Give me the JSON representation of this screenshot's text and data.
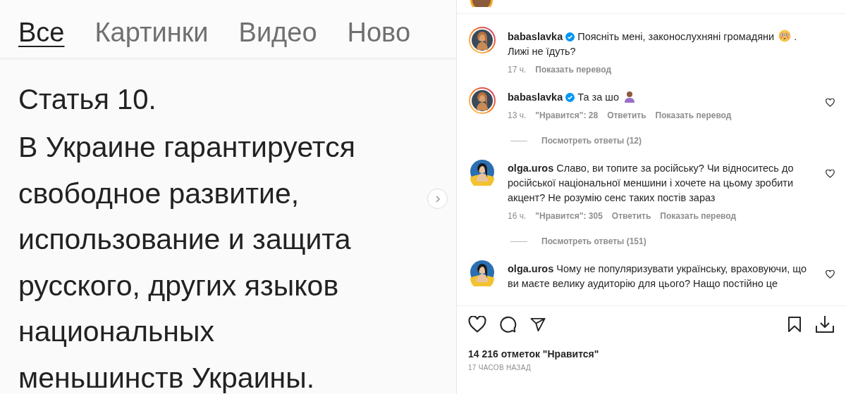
{
  "search_tabs": [
    {
      "label": "Все",
      "selected": true
    },
    {
      "label": "Картинки",
      "selected": false
    },
    {
      "label": "Видео",
      "selected": false
    },
    {
      "label": "Ново",
      "selected": false
    }
  ],
  "article": {
    "title": "Статья 10.",
    "text": "В Украине гарантируется\nсвободное развитие,\nиспользование и защита\nрусского, других языков\nнациональных\nменьшинств Украины."
  },
  "comments": [
    {
      "kind": "caption",
      "username": "babaslavka",
      "verified": true,
      "story_ring": true,
      "text": "Поясніть мені, законослухняні громадяни",
      "emoji": {
        "kind": "flushed"
      },
      "tail": " .\nЛижі не їдуть?",
      "time": "17 ч.",
      "translate": "Показать перевод"
    },
    {
      "kind": "comment",
      "username": "babaslavka",
      "verified": true,
      "story_ring": true,
      "text": "Та за шо",
      "emoji": {
        "kind": "shrug"
      },
      "time": "13 ч.",
      "likes": "\"Нравится\": 28",
      "reply": "Ответить",
      "translate": "Показать перевод",
      "replies": "Посмотреть ответы (12)"
    },
    {
      "kind": "comment",
      "username": "olga.uros",
      "verified": false,
      "story_ring": false,
      "text": "Славо, ви топите за російську? Чи відноситесь до російської національної меншини і хочете на цьому зробити акцент? Не розумію сенс таких постів зараз",
      "time": "16 ч.",
      "likes": "\"Нравится\": 305",
      "reply": "Ответить",
      "translate": "Показать перевод",
      "replies": "Посмотреть ответы (151)"
    },
    {
      "kind": "comment",
      "username": "olga.uros",
      "verified": false,
      "story_ring": false,
      "text": "Чому не популяризувати українську, враховуючи, що ви маєте велику аудиторію для цього? Нащо постійно це"
    }
  ],
  "likes_total": "14 216 отметок \"Нравится\"",
  "posted": "17 ЧАСОВ НАЗАД"
}
